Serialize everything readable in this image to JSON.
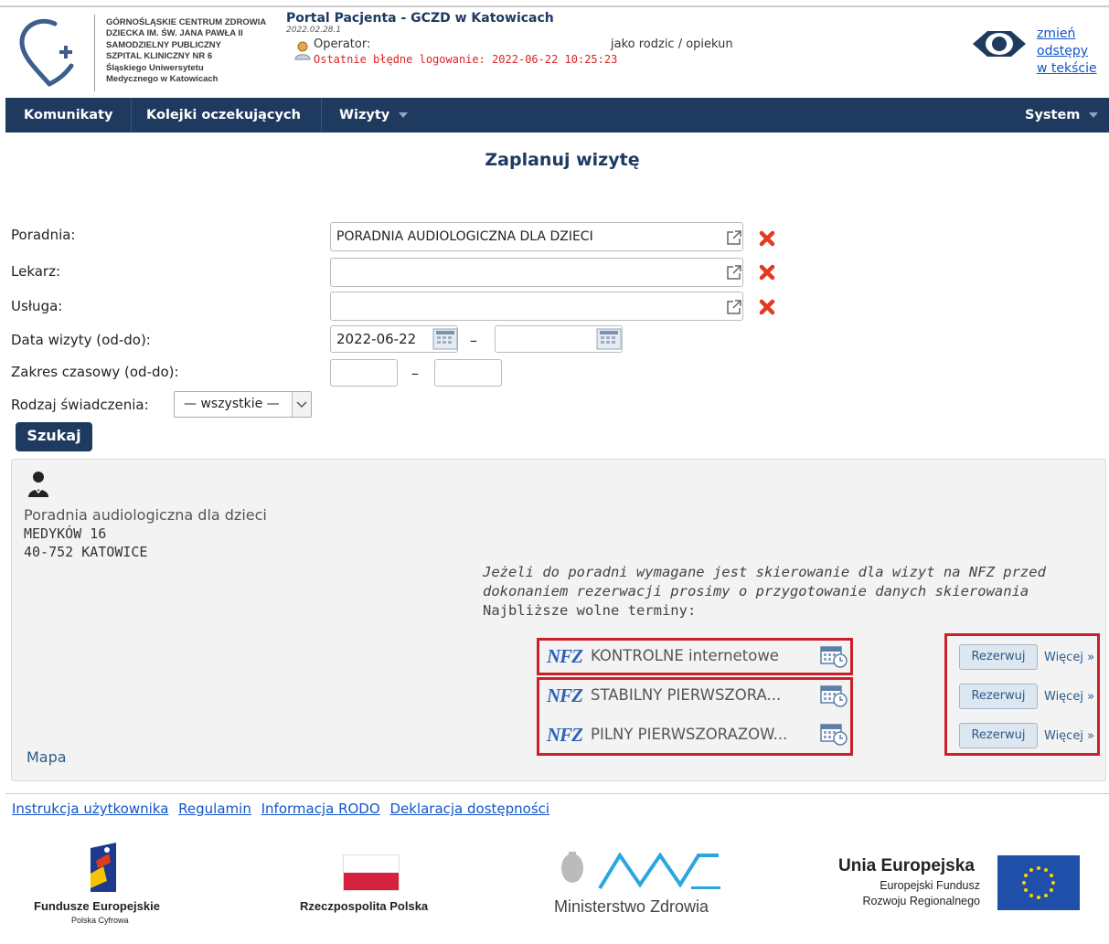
{
  "header": {
    "hospital_lines": [
      "GÓRNOŚLĄSKIE CENTRUM ZDROWIA",
      "DZIECKA IM. ŚW. JANA PAWŁA II",
      "SAMODZIELNY PUBLICZNY",
      "SZPITAL KLINICZNY NR 6",
      "Śląskiego Uniwersytetu",
      "Medycznego w Katowicach"
    ],
    "portal_title": "Portal Pacjenta - GCZD w Katowicach",
    "version": "2022.02.28.1",
    "operator_label": "Operator:",
    "operator_role": "jako rodzic / opiekun",
    "last_login": "Ostatnie błędne logowanie: 2022-06-22 10:25:23",
    "access_link": [
      "zmień",
      "odstępy",
      "w tekście"
    ]
  },
  "nav": {
    "items": [
      "Komunikaty",
      "Kolejki oczekujących",
      "Wizyty"
    ],
    "system": "System"
  },
  "page_title": "Zaplanuj wizytę",
  "form": {
    "clinic_label": "Poradnia:",
    "clinic_value": "PORADNIA AUDIOLOGICZNA DLA DZIECI",
    "doctor_label": "Lekarz:",
    "doctor_value": "",
    "service_label": "Usługa:",
    "service_value": "",
    "date_label": "Data wizyty (od-do):",
    "date_from": "2022-06-22",
    "date_to": "",
    "time_label": "Zakres czasowy (od-do):",
    "time_from": "",
    "time_to": "",
    "type_label": "Rodzaj świadczenia:",
    "type_value": "— wszystkie —",
    "dash": "–",
    "search_button": "Szukaj"
  },
  "result": {
    "clinic_name": "Poradnia audiologiczna dla dzieci",
    "address_1": "MEDYKÓW 16",
    "address_2": "40-752 KATOWICE",
    "note_lines": [
      "Jeżeli do poradni wymagane jest skierowanie dla wizyt na NFZ przed",
      "dokonaniem rezerwacji prosimy o przygotowanie danych skierowania"
    ],
    "nearest_label": "Najbliższe wolne terminy:",
    "nfz_mark": "NFZ",
    "slots": [
      {
        "name": "KONTROLNE internetowe",
        "reserve": "Rezerwuj",
        "more": "Więcej »"
      },
      {
        "name": "STABILNY PIERWSZORA...",
        "reserve": "Rezerwuj",
        "more": "Więcej »"
      },
      {
        "name": "PILNY PIERWSZORAZOW...",
        "reserve": "Rezerwuj",
        "more": "Więcej »"
      }
    ],
    "map_link": "Mapa"
  },
  "footer": {
    "links": [
      "Instrukcja użytkownika",
      "Regulamin",
      "Informacja RODO",
      "Deklaracja dostępności"
    ],
    "logos": {
      "fe_title": "Fundusze Europejskie",
      "fe_sub": "Polska Cyfrowa",
      "rp": "Rzeczpospolita Polska",
      "mz": "Ministerstwo Zdrowia",
      "ue_title": "Unia Europejska",
      "ue_sub_1": "Europejski Fundusz",
      "ue_sub_2": "Rozwoju Regionalnego"
    }
  },
  "colors": {
    "nav_bg": "#1e3a5f",
    "accent_red": "#cc1f2b",
    "link_blue": "#15c",
    "nfz_blue": "#2b63b8"
  }
}
